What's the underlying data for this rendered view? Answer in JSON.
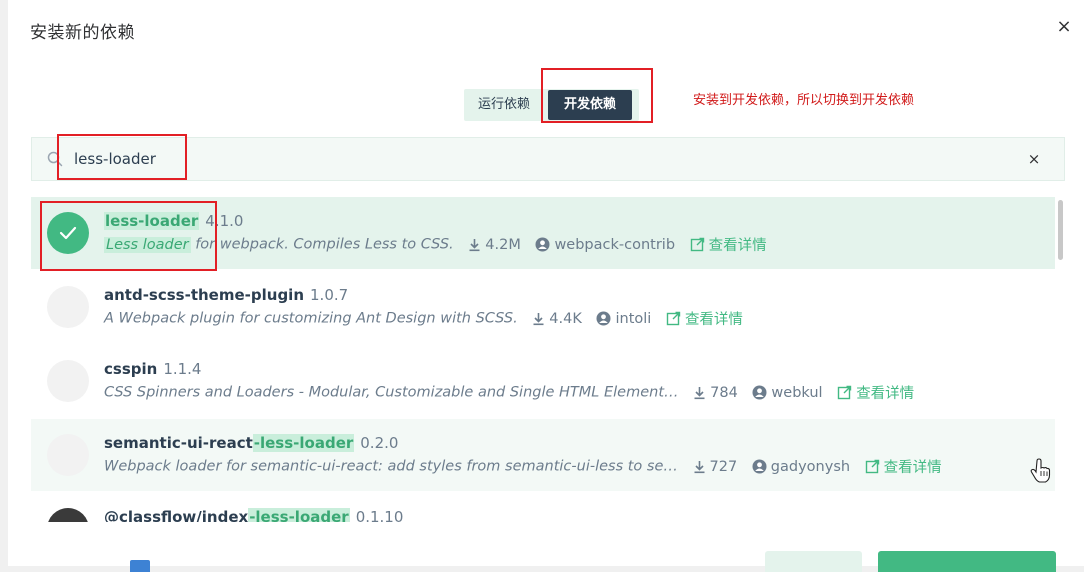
{
  "dialog": {
    "title": "安装新的依赖",
    "close_icon": "×"
  },
  "tabs": {
    "runtime_label": "运行依赖",
    "dev_label": "开发依赖",
    "active": "dev"
  },
  "annotation": "安装到开发依赖，所以切换到开发依赖",
  "search": {
    "value": "less-loader",
    "clear_icon": "×"
  },
  "results": [
    {
      "name": "less-loader",
      "version": "4.1.0",
      "description": "Less loader for webpack. Compiles Less to CSS.",
      "downloads": "4.2M",
      "author": "webpack-contrib",
      "link": "查看详情",
      "selected": true
    },
    {
      "name": "antd-scss-theme-plugin",
      "version": "1.0.7",
      "description": "A Webpack plugin for customizing Ant Design with SCSS.",
      "downloads": "4.4K",
      "author": "intoli",
      "link": "查看详情"
    },
    {
      "name": "csspin",
      "version": "1.1.4",
      "description": "CSS Spinners and Loaders - Modular, Customizable and Single HTML Element…",
      "downloads": "784",
      "author": "webkul",
      "link": "查看详情"
    },
    {
      "name_prefix": "semantic-ui-react",
      "name_match": "-less-loader",
      "version": "0.2.0",
      "description": "Webpack loader for semantic-ui-react: add styles from semantic-ui-less to se…",
      "downloads": "727",
      "author": "gadyonysh",
      "link": "查看详情"
    },
    {
      "name_prefix": "@classflow/index",
      "name_match": "-less-loader",
      "version": "0.1.10"
    }
  ],
  "colors": {
    "accent": "#42b983",
    "dark": "#2c3e50",
    "annotation_red": "#e21f25"
  }
}
